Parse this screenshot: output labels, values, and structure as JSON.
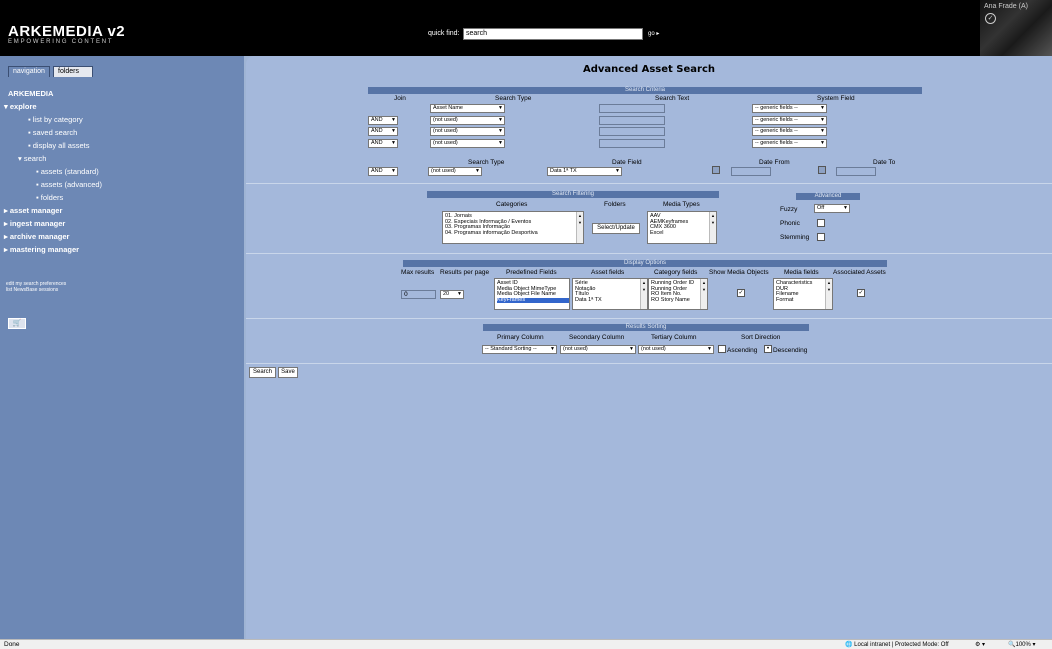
{
  "header": {
    "app_title": "ARKEMEDIA v2",
    "app_subtitle": "EMPOWERING CONTENT",
    "quick_find_label": "quick find:",
    "quick_find_value": "search",
    "go_label": "go ▸",
    "user_name": "Ana Frade (A)"
  },
  "sidebar": {
    "tabs": [
      "navigation",
      "folders"
    ],
    "root": "ARKEMEDIA",
    "items": [
      {
        "label": "explore"
      },
      {
        "label": "list by category"
      },
      {
        "label": "saved search"
      },
      {
        "label": "display all assets"
      },
      {
        "label": "search"
      },
      {
        "label": "assets (standard)"
      },
      {
        "label": "assets (advanced)"
      },
      {
        "label": "folders"
      },
      {
        "label": "asset manager"
      },
      {
        "label": "ingest manager"
      },
      {
        "label": "archive manager"
      },
      {
        "label": "mastering manager"
      }
    ],
    "pref_links": [
      "edit my search preferences",
      "list NewsBase sessions"
    ]
  },
  "page": {
    "title": "Advanced Asset Search",
    "criteria": {
      "section": "Search Criteria",
      "headers": {
        "join": "Join",
        "search_type": "Search Type",
        "search_text": "Search Text",
        "system_field": "System Field"
      },
      "rows": [
        {
          "join": "",
          "type": "Asset Name",
          "field": "-- generic fields --"
        },
        {
          "join": "AND",
          "type": "(not used)",
          "field": "-- generic fields --"
        },
        {
          "join": "AND",
          "type": "(not used)",
          "field": "-- generic fields --"
        },
        {
          "join": "AND",
          "type": "(not used)",
          "field": "-- generic fields --"
        }
      ],
      "date": {
        "headers": {
          "search_type": "Search Type",
          "date_field": "Date Field",
          "date_from": "Date From",
          "date_to": "Date To"
        },
        "join": "AND",
        "type": "(not used)",
        "field": "Data 1ª TX"
      }
    },
    "filtering": {
      "section": "Search Filtering",
      "headers": {
        "categories": "Categories",
        "folders": "Folders",
        "media_types": "Media Types"
      },
      "categories": [
        "01. Jornais",
        "02. Especiais Informação / Eventos",
        "03. Programas Informação",
        "04. Programas informação Desportiva"
      ],
      "select_button": "Select/Update",
      "media_types": [
        "AAV",
        "AEMKeyframes",
        "CMX 3600",
        "Excel"
      ],
      "advanced": {
        "section": "Advanced",
        "fuzzy_label": "Fuzzy",
        "fuzzy_value": "Off",
        "phonic_label": "Phonic",
        "stemming_label": "Stemming"
      }
    },
    "display": {
      "section": "Display Options",
      "headers": {
        "max_results": "Max results",
        "per_page": "Results per page",
        "predefined": "Predefined Fields",
        "asset_fields": "Asset fields",
        "category_fields": "Category fields",
        "show_media": "Show Media Objects",
        "media_fields": "Media fields",
        "associated": "Associated Assets"
      },
      "max_results": "0",
      "per_page": "20",
      "predefined": [
        "Asset ID",
        "Media Object MimeType",
        "Media Object File Name",
        "KeyFrames"
      ],
      "asset_fields": [
        "Série",
        "Notação",
        "Título",
        "Data 1ª TX"
      ],
      "category_fields": [
        "Running Order ID",
        "Running Order",
        "RO Item No.",
        "RO Story Name"
      ],
      "media_fields": [
        "Characteristics",
        "DUR",
        "Filename",
        "Format"
      ]
    },
    "sorting": {
      "section": "Results Sorting",
      "headers": {
        "primary": "Primary Column",
        "secondary": "Secondary Column",
        "tertiary": "Tertiary Column",
        "direction": "Sort Direction"
      },
      "primary": "-- Standard Sorting --",
      "secondary": "(not used)",
      "tertiary": "(not used)",
      "ascending": "Ascending",
      "descending": "Descending"
    },
    "buttons": {
      "search": "Search",
      "save": "Save"
    }
  },
  "status": {
    "left": "Done",
    "zone": "Local intranet | Protected Mode: Off",
    "zoom": "100%"
  }
}
